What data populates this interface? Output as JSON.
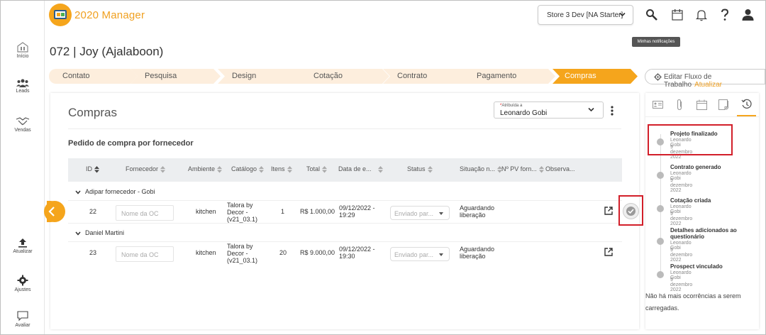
{
  "nav": {
    "items": [
      {
        "label": "Início"
      },
      {
        "label": "Leads"
      },
      {
        "label": "Vendas"
      },
      {
        "label": "Atualizar"
      },
      {
        "label": "Ajustes"
      },
      {
        "label": "Avaliar"
      }
    ]
  },
  "header": {
    "brand": "2020 Manager",
    "store": "Store 3 Dev [NA Starter]",
    "tooltip": "Minhas notificações"
  },
  "page": {
    "title": "072 | Joy (Ajalaboon)"
  },
  "stepper": {
    "steps": [
      "Contato",
      "Pesquisa",
      "Design",
      "Cotação",
      "Contrato",
      "Pagamento",
      "Compras"
    ],
    "active": "Compras"
  },
  "workflow": {
    "label": "Editar Fluxo de Trabalho",
    "update": "Atualizar"
  },
  "main": {
    "title": "Compras",
    "assign_label": "Atribuída a",
    "assign_required": "*",
    "assign_value": "Leonardo Gobi",
    "subtitle": "Pedido de compra por fornecedor",
    "columns": [
      "ID",
      "Fornecedor",
      "Ambiente",
      "Catálogo",
      "Itens",
      "Total",
      "Data de e...",
      "Status",
      "Situação n...",
      "Nº PV forn...",
      "Observa..."
    ],
    "groups": [
      {
        "name": "Adipar fornecedor - Gobi",
        "rows": [
          {
            "id": "22",
            "oc_placeholder": "Nome da OC",
            "ambiente": "kitchen",
            "catalogo": "Talora by Decor - (v21_03.1)",
            "itens": "1",
            "total": "R$ 1.000,00",
            "data": "09/12/2022 - 19:29",
            "status": "Enviado par...",
            "situacao": "Aguardando liberação"
          }
        ]
      },
      {
        "name": "Daniel Martini",
        "rows": [
          {
            "id": "23",
            "oc_placeholder": "Nome da OC",
            "ambiente": "kitchen",
            "catalogo": "Talora by Decor - (v21_03.1)",
            "itens": "20",
            "total": "R$ 9.000,00",
            "data": "09/12/2022 - 19:30",
            "status": "Enviado par...",
            "situacao": "Aguardando liberação"
          }
        ]
      }
    ]
  },
  "history": {
    "events": [
      {
        "title": "Projeto finalizado",
        "user": "Leonardo Gobi",
        "date": "9 dezembro 2022"
      },
      {
        "title": "Contrato generado",
        "user": "Leonardo Gobi",
        "date": "9 dezembro 2022"
      },
      {
        "title": "Cotação criada",
        "user": "Leonardo Gobi",
        "date": "9 dezembro 2022"
      },
      {
        "title": "Detalhes adicionados ao questionário",
        "user": "Leonardo Gobi",
        "date": "9 dezembro 2022"
      },
      {
        "title": "Prospect vinculado",
        "user": "Leonardo Gobi",
        "date": "9 dezembro 2022"
      }
    ],
    "no_more": "Não há mais ocorrências a serem carregadas."
  },
  "colors": {
    "accent": "#f5a51c",
    "highlight": "#d21f2a",
    "step_bg": "#fdeedd"
  }
}
